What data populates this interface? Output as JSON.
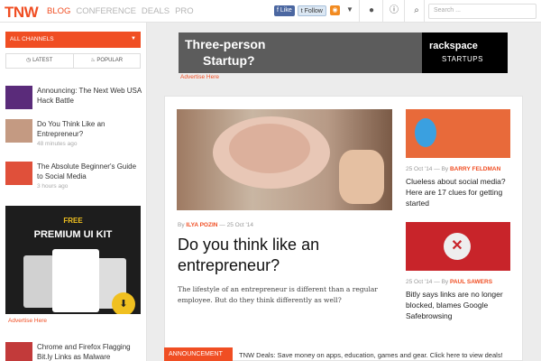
{
  "header": {
    "logo": "TNW",
    "nav": [
      "BLOG",
      "CONFERENCE",
      "DEALS",
      "PRO"
    ],
    "facebook_label": "Like",
    "twitter_label": "Follow",
    "search_placeholder": "Search ..."
  },
  "sidebar": {
    "channels_label": "ALL CHANNELS",
    "tabs": [
      "LATEST",
      "POPULAR"
    ],
    "items": [
      {
        "title": "Announcing: The Next Web USA Hack Battle",
        "time": ""
      },
      {
        "title": "Do You Think Like an Entrepreneur?",
        "time": "48 minutes ago"
      },
      {
        "title": "The Absolute Beginner's Guide to Social Media",
        "time": "3 hours ago"
      },
      {
        "title": "Chrome and Firefox Flagging Bit.ly Links as Malware",
        "time": ""
      }
    ],
    "ad": {
      "free": "FREE",
      "title": "PREMIUM UI KIT",
      "advertise": "Advertise Here"
    }
  },
  "banner": {
    "text_line1": "Three-person",
    "text_line2": "Startup?",
    "logo_name": "rackspace",
    "logo_sub": "STARTUPS",
    "advertise": "Advertise Here"
  },
  "hero": {
    "by": "By",
    "author": "ILYA POZIN",
    "date": "25 Oct '14",
    "title": "Do you think like an entrepreneur?",
    "excerpt": "The lifestyle of an entrepreneur is different than a regular employee. But do they think differently as well?"
  },
  "cards": [
    {
      "by": "By",
      "date": "25 Oct '14",
      "author": "BARRY FELDMAN",
      "title": "Clueless about social media? Here are 17 clues for getting started"
    },
    {
      "by": "By",
      "date": "25 Oct '14",
      "author": "PAUL SAWERS",
      "title": "Bitly says links are no longer blocked, blames Google Safebrowsing"
    }
  ],
  "announcement": {
    "label": "ANNOUNCEMENT",
    "text": "TNW Deals: Save money on apps, education, games and gear. Click here to view deals!"
  },
  "colors": {
    "accent": "#f04e23",
    "background": "#ececec"
  }
}
